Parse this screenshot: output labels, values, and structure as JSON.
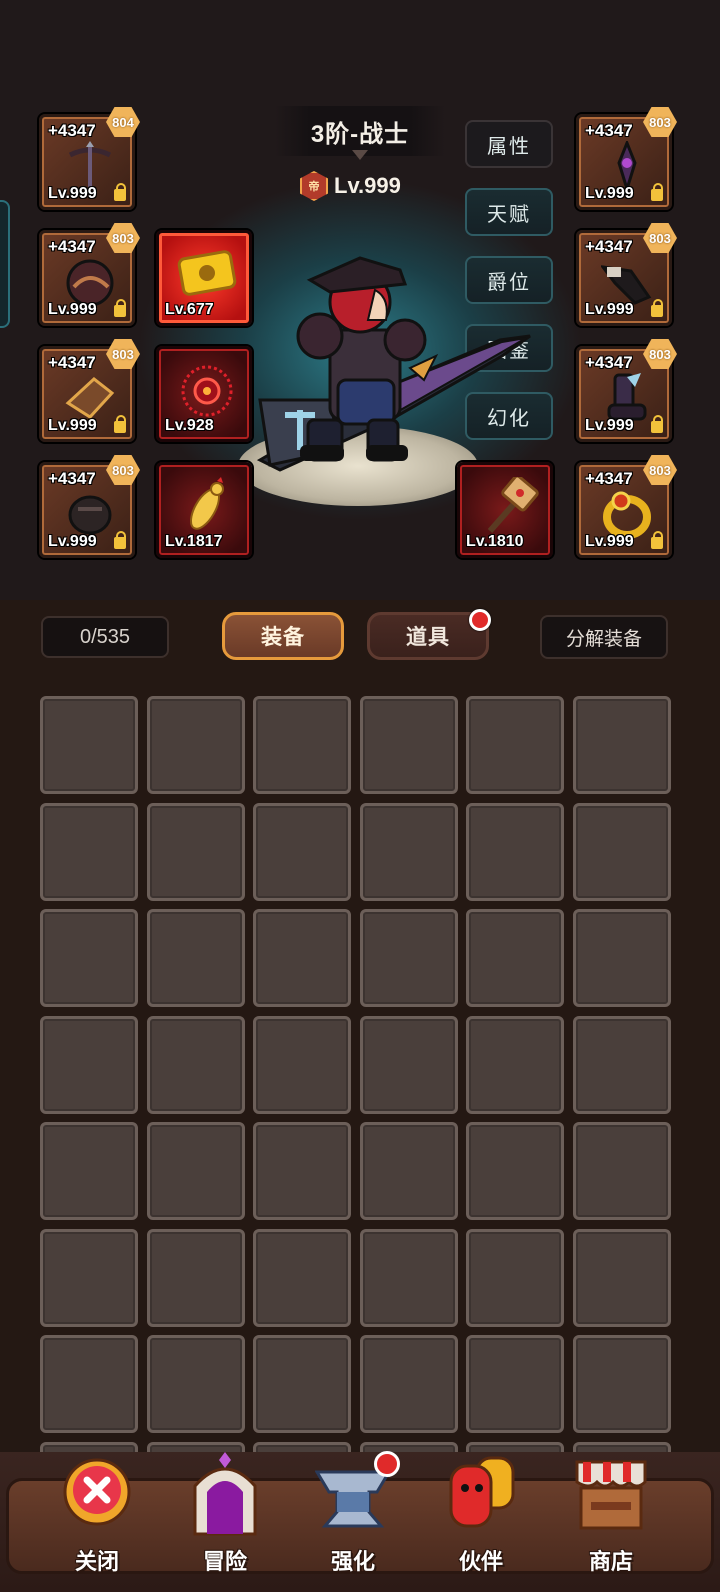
{
  "header": {
    "title": "3阶-战士",
    "rank_badge": "帝",
    "level": "Lv.999"
  },
  "side_menu": [
    "属性",
    "天赋",
    "爵位",
    "图鉴",
    "幻化"
  ],
  "equipment_left": [
    {
      "plus": "+4347",
      "badge": "804",
      "level": "Lv.999",
      "icon": "crossbow-icon"
    },
    {
      "plus": "+4347",
      "badge": "803",
      "level": "Lv.999",
      "icon": "helmet-icon"
    },
    {
      "plus": "+4347",
      "badge": "803",
      "level": "Lv.999",
      "icon": "shoulder-armor-icon"
    },
    {
      "plus": "+4347",
      "badge": "803",
      "level": "Lv.999",
      "icon": "gauntlet-icon"
    }
  ],
  "equipment_right": [
    {
      "plus": "+4347",
      "badge": "803",
      "level": "Lv.999",
      "icon": "amulet-icon"
    },
    {
      "plus": "+4347",
      "badge": "803",
      "level": "Lv.999",
      "icon": "bracer-icon"
    },
    {
      "plus": "+4347",
      "badge": "803",
      "level": "Lv.999",
      "icon": "boots-icon"
    },
    {
      "plus": "+4347",
      "badge": "803",
      "level": "Lv.999",
      "icon": "ring-icon"
    }
  ],
  "specials": [
    {
      "level": "Lv.677",
      "icon": "gold-ticket-icon"
    },
    {
      "level": "Lv.928",
      "icon": "crimson-sigil-icon"
    },
    {
      "level": "Lv.1817",
      "icon": "chicken-icon"
    },
    {
      "level": "Lv.1810",
      "icon": "hammer-icon"
    }
  ],
  "inventory": {
    "count": "0/535",
    "tabs": [
      "装备",
      "道具"
    ],
    "active_tab": "装备",
    "decompose_label": "分解装备",
    "columns": 6,
    "visible_rows": 7
  },
  "nav": [
    {
      "label": "关闭",
      "icon": "close-icon"
    },
    {
      "label": "冒险",
      "icon": "portal-gate-icon"
    },
    {
      "label": "强化",
      "icon": "anvil-icon"
    },
    {
      "label": "伙伴",
      "icon": "companion-icon"
    },
    {
      "label": "商店",
      "icon": "shop-stall-icon"
    }
  ],
  "colors": {
    "accent": "#e69a3c",
    "notification": "#e02a2a",
    "slot_border": "#b06a3a",
    "special_border": "#b02020"
  }
}
